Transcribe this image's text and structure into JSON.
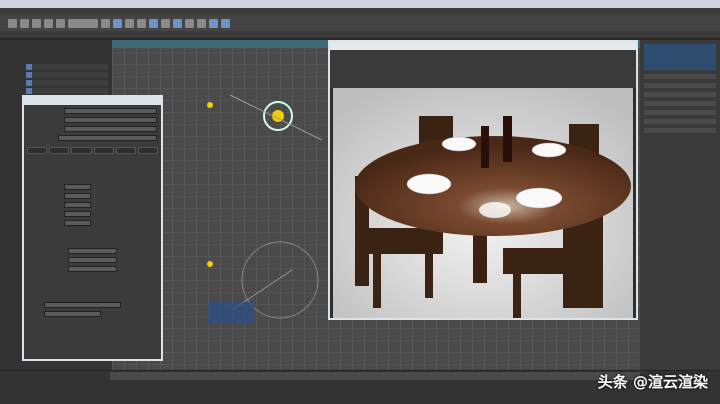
{
  "watermark": "头条 @渲云渲染",
  "colors": {
    "accent": "#6f93c6",
    "viewport": "#4a4a4a",
    "dialog_border": "#dde3ea",
    "table_wood": "#6b3e26"
  },
  "render_setup": {
    "tabs": [
      "",
      "",
      "",
      "",
      "",
      ""
    ]
  },
  "icons": [
    "select-icon",
    "move-icon",
    "rotate-icon",
    "scale-icon",
    "render-icon",
    "teapot-icon",
    "light-icon",
    "camera-icon"
  ]
}
